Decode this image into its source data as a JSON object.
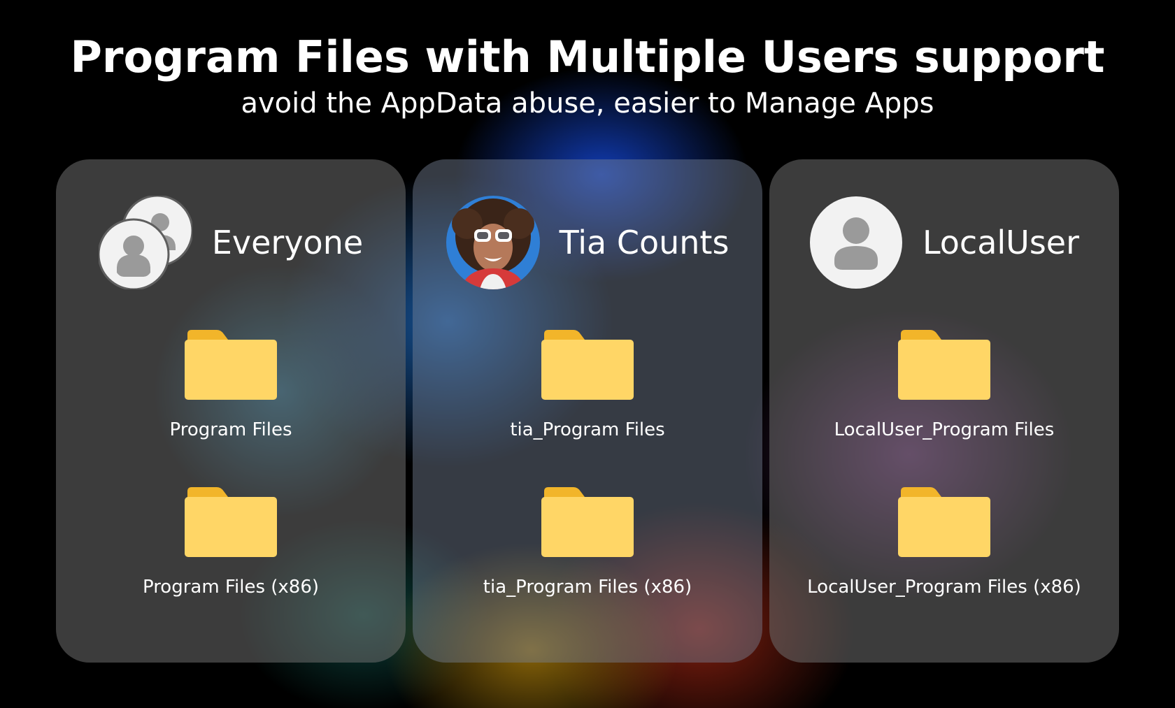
{
  "header": {
    "title": "Program Files with Multiple Users support",
    "subtitle": "avoid the AppData abuse, easier to Manage Apps"
  },
  "panels": [
    {
      "user_name": "Everyone",
      "avatar_icon": "group-users-icon",
      "folders": [
        {
          "label": "Program Files",
          "icon": "folder-icon"
        },
        {
          "label": "Program Files (x86)",
          "icon": "folder-icon"
        }
      ]
    },
    {
      "user_name": "Tia Counts",
      "avatar_icon": "user-photo-avatar",
      "folders": [
        {
          "label": "tia_Program Files",
          "icon": "folder-icon"
        },
        {
          "label": "tia_Program Files (x86)",
          "icon": "folder-icon"
        }
      ]
    },
    {
      "user_name": "LocalUser",
      "avatar_icon": "user-icon",
      "folders": [
        {
          "label": "LocalUser_Program Files",
          "icon": "folder-icon"
        },
        {
          "label": "LocalUser_Program Files (x86)",
          "icon": "folder-icon"
        }
      ]
    }
  ],
  "colors": {
    "folder_back": "#f2b52a",
    "folder_front": "#ffd666",
    "avatar_bg": "#f2f2f2",
    "avatar_glyph": "#9a9a9a"
  }
}
